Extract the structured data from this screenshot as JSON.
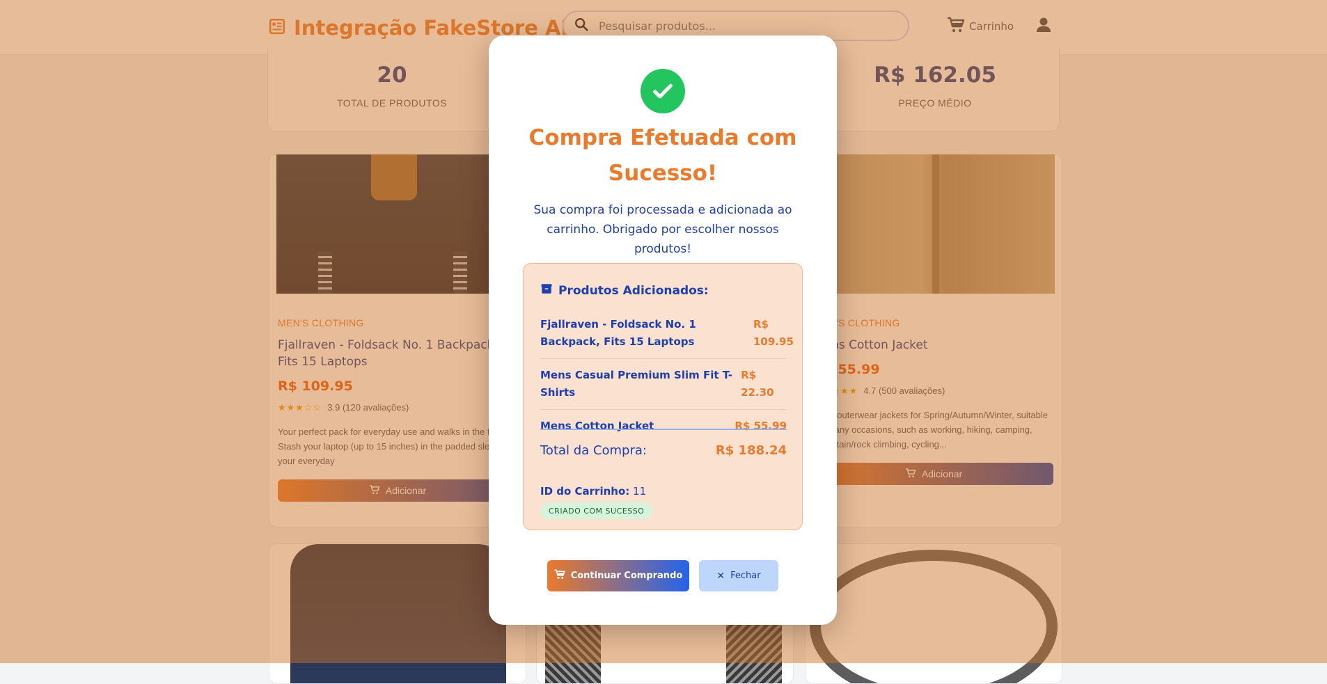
{
  "header": {
    "brand_title": "Integração FakeStore API",
    "search_placeholder": "Pesquisar produtos...",
    "cart_label": "Carrinho"
  },
  "stats": [
    {
      "value": "20",
      "label": "TOTAL DE PRODUTOS"
    },
    {
      "value": "R$ 162.05",
      "label": "PREÇO MÉDIO"
    }
  ],
  "products": [
    {
      "category": "MEN'S CLOTHING",
      "title": "Fjallraven - Foldsack No. 1 Backpack, Fits 15 Laptops",
      "price": "R$ 109.95",
      "rating_stars": 3.9,
      "rating_text": "3.9 (120 avaliações)",
      "description": "Your perfect pack for everyday use and walks in the forest. Stash your laptop (up to 15 inches) in the padded sleeve, your everyday",
      "button_label": "Adicionar"
    },
    {
      "category": "MEN'S CLOTHING",
      "title": "Mens Cotton Jacket",
      "price": "R$ 55.99",
      "rating_stars": 4.7,
      "rating_text": "4.7 (500 avaliações)",
      "description": "great outerwear jackets for Spring/Autumn/Winter, suitable for many occasions, such as working, hiking, camping, mountain/rock climbing, cycling...",
      "button_label": "Adicionar"
    }
  ],
  "modal": {
    "title": "Compra Efetuada com Sucesso!",
    "message": "Sua compra foi processada e adicionada ao carrinho. Obrigado por escolher nossos produtos!",
    "summary_heading": "Produtos Adicionados:",
    "items": [
      {
        "name": "Fjallraven - Foldsack No. 1 Backpack, Fits 15 Laptops",
        "price": "R$ 109.95"
      },
      {
        "name": "Mens Casual Premium Slim Fit T-Shirts",
        "price": "R$ 22.30"
      },
      {
        "name": "Mens Cotton Jacket",
        "price": "R$ 55.99"
      }
    ],
    "total_label": "Total da Compra:",
    "total_value": "R$ 188.24",
    "cart_id_label": "ID do Carrinho:",
    "cart_id_value": "11",
    "status_badge": "CRIADO COM SUCESSO",
    "continue_label": "Continuar Comprando",
    "close_label": "Fechar"
  },
  "colors": {
    "accent_orange": "#ea7a2c",
    "accent_blue": "#1e40af",
    "success_green": "#22c55e",
    "overlay": "rgba(204,115,40,0.48)"
  },
  "icons": {
    "brand": "newspaper-icon",
    "search": "search-icon",
    "cart": "shopping-cart-icon",
    "user": "user-icon",
    "success": "check-icon",
    "summary": "box-icon",
    "close": "close-icon"
  }
}
